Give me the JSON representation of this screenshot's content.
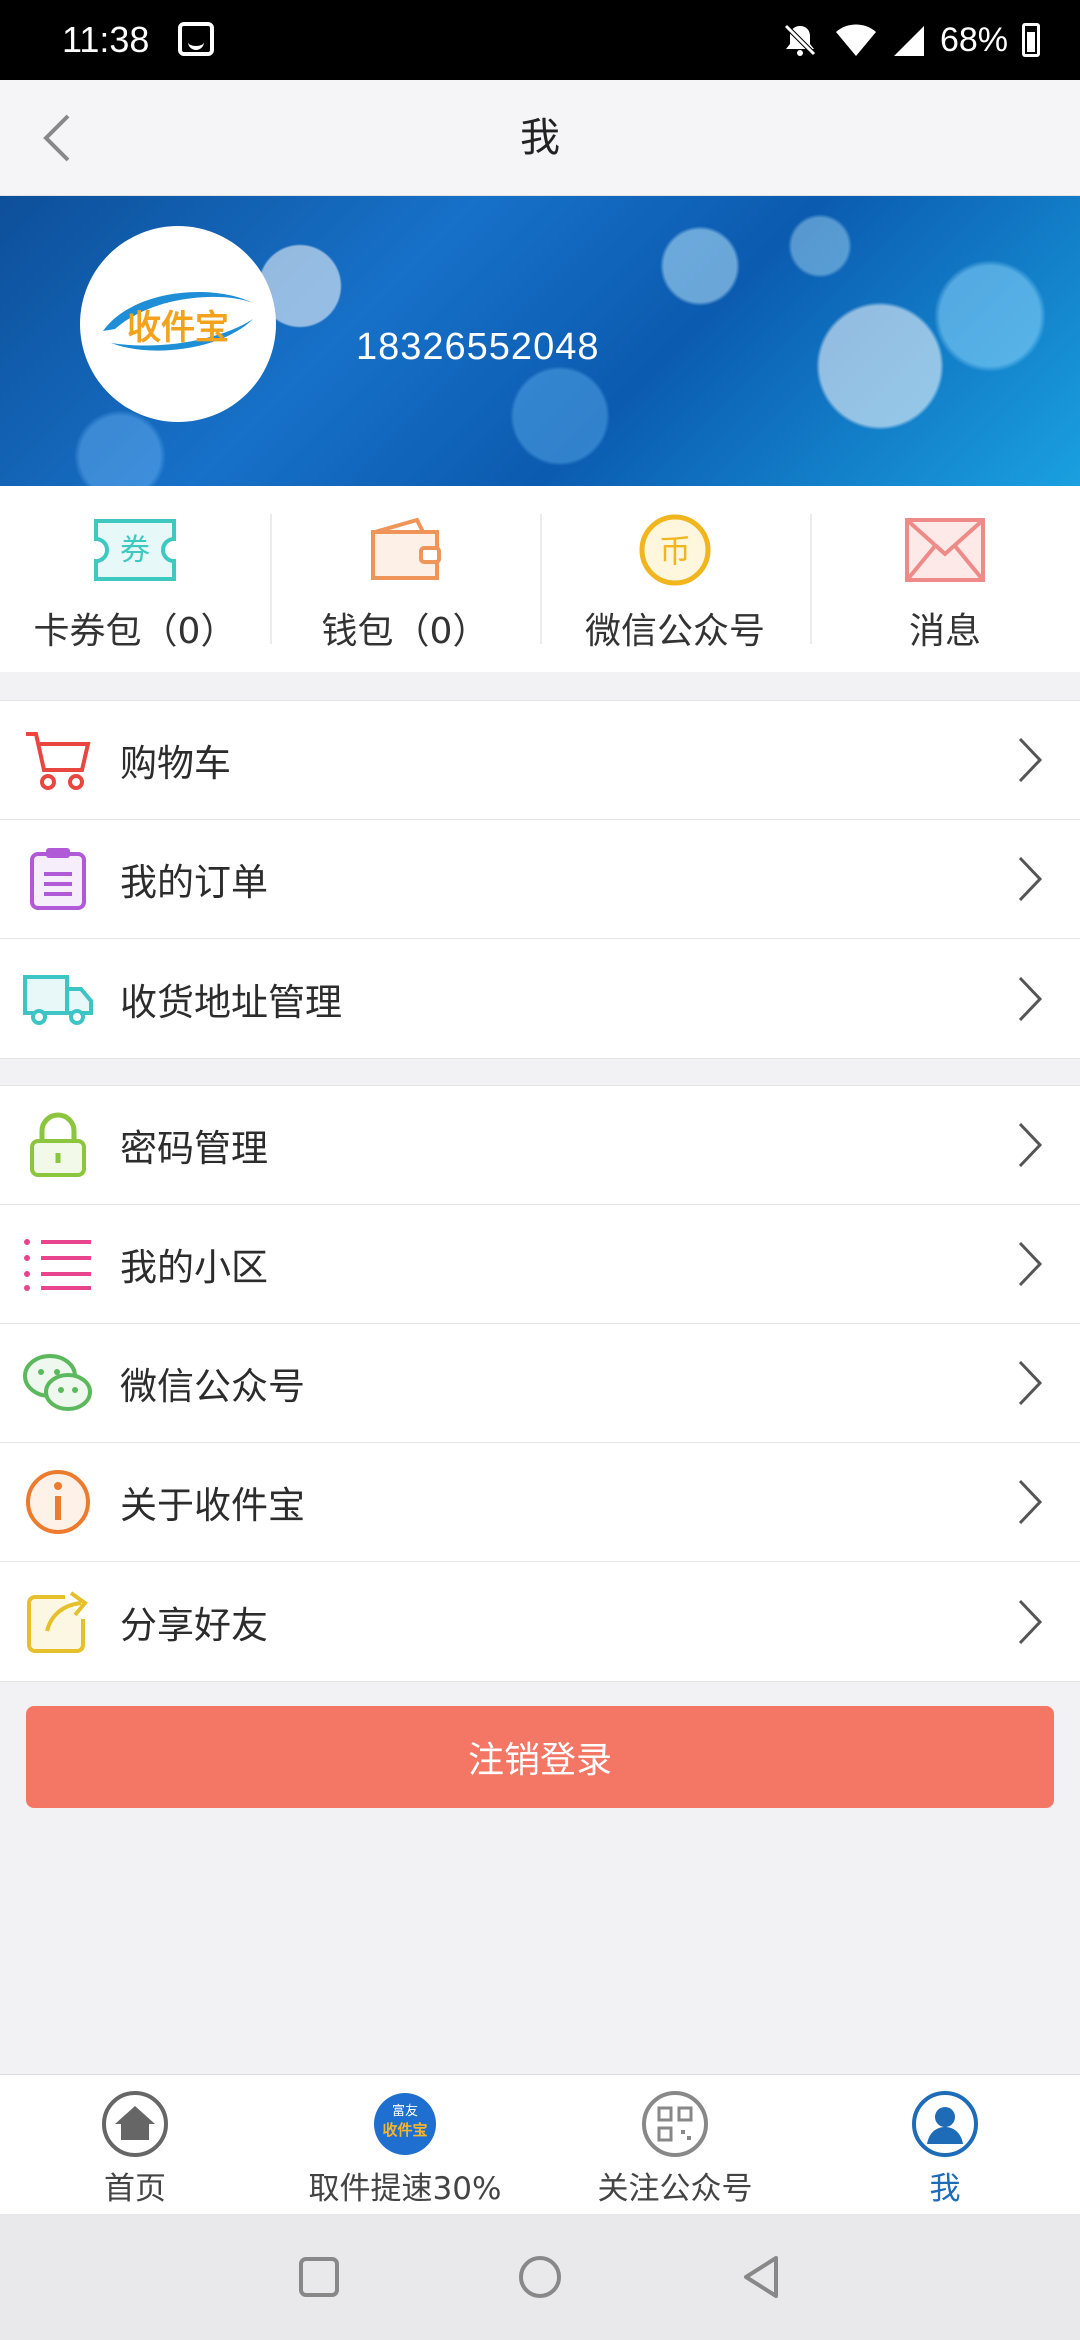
{
  "status_bar": {
    "time": "11:38",
    "battery": "68%"
  },
  "header": {
    "title": "我"
  },
  "profile": {
    "phone": "18326552048",
    "logo_text": "收件宝"
  },
  "quick_actions": [
    {
      "label": "卡券包（0）",
      "icon": "coupon-icon",
      "icon_text": "券",
      "color": "#3dc9c0"
    },
    {
      "label": "钱包（0）",
      "icon": "wallet-icon",
      "color": "#f0955a"
    },
    {
      "label": "微信公众号",
      "icon": "coin-icon",
      "icon_text": "币",
      "color": "#f1b51d"
    },
    {
      "label": "消息",
      "icon": "mail-icon",
      "color": "#ee8b88"
    }
  ],
  "menu_group_1": [
    {
      "label": "购物车",
      "icon": "cart-icon",
      "color": "#e8463f"
    },
    {
      "label": "我的订单",
      "icon": "order-icon",
      "color": "#b05ad8"
    },
    {
      "label": "收货地址管理",
      "icon": "truck-icon",
      "color": "#3cc5c4"
    }
  ],
  "menu_group_2": [
    {
      "label": "密码管理",
      "icon": "lock-icon",
      "color": "#8cc63f"
    },
    {
      "label": "我的小区",
      "icon": "list-icon",
      "color": "#e9458f"
    },
    {
      "label": "微信公众号",
      "icon": "wechat-icon",
      "color": "#5cb85c"
    },
    {
      "label": "关于收件宝",
      "icon": "info-icon",
      "color": "#ec7b2e"
    },
    {
      "label": "分享好友",
      "icon": "share-icon",
      "color": "#e6c02a"
    }
  ],
  "logout": {
    "label": "注销登录"
  },
  "bottom_nav": [
    {
      "label": "首页",
      "icon": "home-icon"
    },
    {
      "label": "取件提速30%",
      "icon": "app-logo-icon",
      "icon_text": "收件宝",
      "icon_top": "富友"
    },
    {
      "label": "关注公众号",
      "icon": "qrcode-icon"
    },
    {
      "label": "我",
      "icon": "user-icon",
      "active": true
    }
  ],
  "colors": {
    "accent": "#1e6bb8",
    "logout": "#f47766"
  }
}
